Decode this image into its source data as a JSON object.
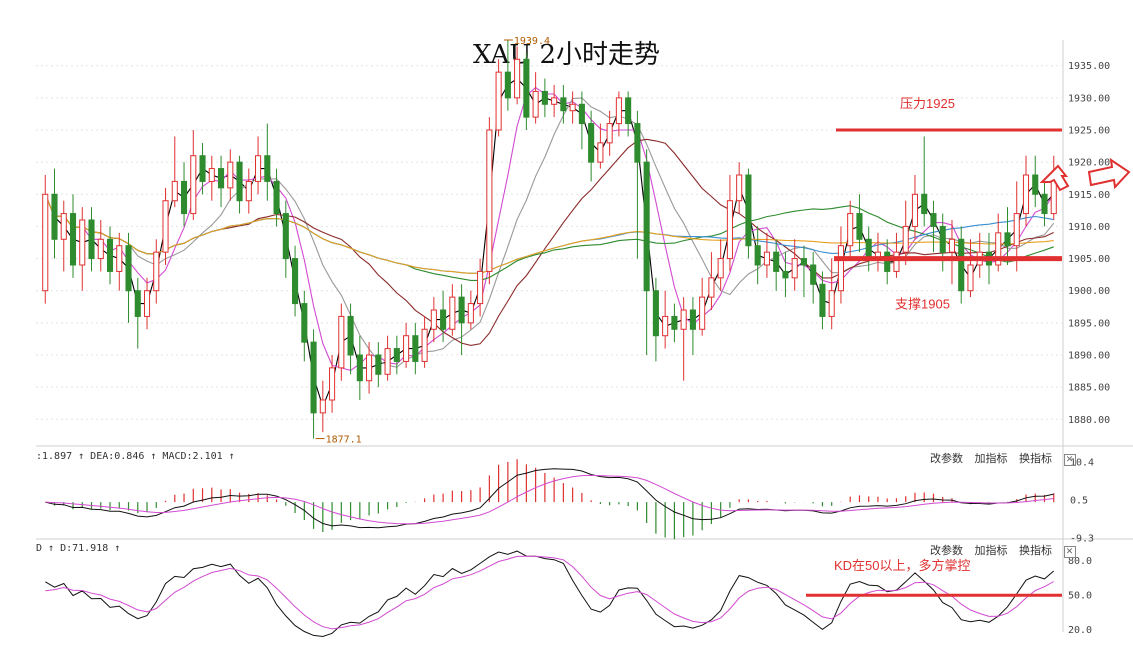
{
  "title": "XAU 2小时走势",
  "panes": {
    "macd": {
      "info": ":1.897 ↑ DEA:0.846 ↑ MACD:2.101 ↑",
      "buttons": [
        "改参数",
        "加指标",
        "换指标"
      ]
    },
    "kd": {
      "info": "D ↑ D:71.918 ↑",
      "buttons": [
        "改参数",
        "加指标",
        "换指标"
      ]
    }
  },
  "colors": {
    "up": "#e03030",
    "down": "#2e8b2e",
    "annotation": "#e03030",
    "ma_black": "#000000",
    "ma_magenta": "#d24ad2",
    "ma_gray": "#999999",
    "ma_brown": "#8b2a2a",
    "ma_green": "#2e8b2e",
    "ma_blue": "#3a8fd0",
    "ma_orange": "#e8a020"
  },
  "chart_data": [
    {
      "type": "candlestick",
      "title": "XAU 2小时走势",
      "y_ticks": [
        1880,
        1885,
        1890,
        1895,
        1900,
        1905,
        1910,
        1915,
        1920,
        1925,
        1930,
        1935
      ],
      "ylim": [
        1876,
        1939
      ],
      "y_tick_format": "two_decimals",
      "high_label": "1939.4",
      "low_label": "1877.1",
      "annotations": [
        {
          "text": "压力1925",
          "price": 1925
        },
        {
          "text": "支撑1905",
          "price": 1905
        }
      ],
      "candles": [
        [
          1900,
          1915,
          1918,
          1898
        ],
        [
          1915,
          1908,
          1919,
          1905
        ],
        [
          1908,
          1912,
          1914,
          1903
        ],
        [
          1912,
          1904,
          1915,
          1902
        ],
        [
          1904,
          1911,
          1913,
          1900
        ],
        [
          1911,
          1905,
          1913,
          1903
        ],
        [
          1905,
          1908,
          1911,
          1903
        ],
        [
          1908,
          1903,
          1910,
          1901
        ],
        [
          1903,
          1907,
          1909,
          1900
        ],
        [
          1907,
          1900,
          1909,
          1895
        ],
        [
          1900,
          1896,
          1902,
          1891
        ],
        [
          1896,
          1900,
          1902,
          1894
        ],
        [
          1900,
          1906,
          1908,
          1898
        ],
        [
          1906,
          1914,
          1916,
          1904
        ],
        [
          1914,
          1917,
          1924,
          1913
        ],
        [
          1917,
          1912,
          1920,
          1910
        ],
        [
          1912,
          1921,
          1925,
          1911
        ],
        [
          1921,
          1917,
          1923,
          1915
        ],
        [
          1917,
          1919,
          1921,
          1914
        ],
        [
          1919,
          1916,
          1921,
          1913
        ],
        [
          1916,
          1920,
          1922,
          1914
        ],
        [
          1920,
          1914,
          1921,
          1912
        ],
        [
          1914,
          1917,
          1919,
          1912
        ],
        [
          1917,
          1921,
          1924,
          1915
        ],
        [
          1921,
          1917,
          1926,
          1914
        ],
        [
          1917,
          1912,
          1919,
          1910
        ],
        [
          1912,
          1905,
          1914,
          1902
        ],
        [
          1905,
          1898,
          1907,
          1896
        ],
        [
          1898,
          1892,
          1900,
          1889
        ],
        [
          1892,
          1881,
          1894,
          1877
        ],
        [
          1881,
          1883,
          1886,
          1878
        ],
        [
          1883,
          1888,
          1890,
          1881
        ],
        [
          1888,
          1896,
          1898,
          1886
        ],
        [
          1896,
          1890,
          1898,
          1887
        ],
        [
          1890,
          1886,
          1893,
          1883
        ],
        [
          1886,
          1890,
          1892,
          1884
        ],
        [
          1890,
          1887,
          1892,
          1885
        ],
        [
          1887,
          1891,
          1893,
          1886
        ],
        [
          1891,
          1889,
          1893,
          1887
        ],
        [
          1889,
          1893,
          1895,
          1888
        ],
        [
          1893,
          1889,
          1895,
          1887
        ],
        [
          1889,
          1894,
          1896,
          1888
        ],
        [
          1894,
          1897,
          1899,
          1892
        ],
        [
          1897,
          1894,
          1900,
          1892
        ],
        [
          1894,
          1899,
          1901,
          1893
        ],
        [
          1899,
          1895,
          1901,
          1890
        ],
        [
          1895,
          1898,
          1900,
          1894
        ],
        [
          1898,
          1903,
          1905,
          1896
        ],
        [
          1903,
          1925,
          1927,
          1901
        ],
        [
          1925,
          1934,
          1936,
          1924
        ],
        [
          1934,
          1930,
          1939,
          1928
        ],
        [
          1930,
          1936,
          1938,
          1929
        ],
        [
          1936,
          1927,
          1937,
          1925
        ],
        [
          1927,
          1931,
          1934,
          1926
        ],
        [
          1931,
          1929,
          1933,
          1927
        ],
        [
          1929,
          1930,
          1932,
          1927
        ],
        [
          1930,
          1928,
          1932,
          1926
        ],
        [
          1928,
          1929,
          1931,
          1926
        ],
        [
          1929,
          1926,
          1931,
          1922
        ],
        [
          1926,
          1920,
          1928,
          1917
        ],
        [
          1920,
          1923,
          1926,
          1919
        ],
        [
          1923,
          1926,
          1928,
          1921
        ],
        [
          1926,
          1930,
          1931,
          1924
        ],
        [
          1930,
          1926,
          1931,
          1924
        ],
        [
          1926,
          1920,
          1928,
          1905
        ],
        [
          1920,
          1900,
          1922,
          1890
        ],
        [
          1900,
          1893,
          1902,
          1889
        ],
        [
          1893,
          1896,
          1900,
          1891
        ],
        [
          1896,
          1894,
          1898,
          1892
        ],
        [
          1894,
          1897,
          1899,
          1886
        ],
        [
          1897,
          1894,
          1899,
          1890
        ],
        [
          1894,
          1899,
          1902,
          1893
        ],
        [
          1899,
          1902,
          1906,
          1897
        ],
        [
          1902,
          1905,
          1908,
          1900
        ],
        [
          1905,
          1914,
          1918,
          1903
        ],
        [
          1914,
          1918,
          1920,
          1912
        ],
        [
          1918,
          1907,
          1919,
          1905
        ],
        [
          1907,
          1904,
          1910,
          1901
        ],
        [
          1904,
          1906,
          1909,
          1902
        ],
        [
          1906,
          1903,
          1908,
          1900
        ],
        [
          1903,
          1902,
          1906,
          1899
        ],
        [
          1902,
          1905,
          1908,
          1900
        ],
        [
          1905,
          1904,
          1907,
          1899
        ],
        [
          1904,
          1901,
          1906,
          1898
        ],
        [
          1901,
          1896,
          1903,
          1894
        ],
        [
          1896,
          1900,
          1905,
          1894
        ],
        [
          1900,
          1907,
          1910,
          1898
        ],
        [
          1907,
          1912,
          1914,
          1905
        ],
        [
          1912,
          1908,
          1915,
          1906
        ],
        [
          1908,
          1905,
          1910,
          1903
        ],
        [
          1905,
          1906,
          1909,
          1903
        ],
        [
          1906,
          1903,
          1908,
          1901
        ],
        [
          1903,
          1906,
          1909,
          1902
        ],
        [
          1906,
          1910,
          1914,
          1904
        ],
        [
          1910,
          1915,
          1918,
          1908
        ],
        [
          1915,
          1912,
          1924,
          1910
        ],
        [
          1912,
          1910,
          1914,
          1906
        ],
        [
          1910,
          1906,
          1912,
          1903
        ],
        [
          1906,
          1908,
          1911,
          1901
        ],
        [
          1908,
          1900,
          1910,
          1898
        ],
        [
          1900,
          1904,
          1908,
          1899
        ],
        [
          1904,
          1906,
          1909,
          1902
        ],
        [
          1906,
          1904,
          1909,
          1901
        ],
        [
          1904,
          1909,
          1912,
          1903
        ],
        [
          1909,
          1907,
          1913,
          1904
        ],
        [
          1907,
          1912,
          1917,
          1903
        ],
        [
          1912,
          1918,
          1921,
          1910
        ],
        [
          1918,
          1915,
          1921,
          1913
        ],
        [
          1915,
          1912,
          1917,
          1910
        ],
        [
          1912,
          1918,
          1921,
          1911
        ]
      ],
      "moving_averages": [
        {
          "color_key": "ma_black",
          "period": 2
        },
        {
          "color_key": "ma_magenta",
          "period": 5
        },
        {
          "color_key": "ma_gray",
          "period": 10
        },
        {
          "color_key": "ma_brown",
          "period": 20
        },
        {
          "color_key": "ma_green",
          "period": 40
        },
        {
          "color_key": "ma_blue",
          "period": 60
        },
        {
          "color_key": "ma_orange",
          "period": 100
        }
      ]
    },
    {
      "type": "macd",
      "y_ticks": [
        10.4,
        0.5,
        -9.3
      ],
      "ylim": [
        -9.3,
        10.4
      ]
    },
    {
      "type": "kd",
      "y_ticks": [
        20,
        50,
        80
      ],
      "y_tick_format": "one_decimal",
      "ylim": [
        18,
        85
      ],
      "annotation": {
        "text": "KD在50以上，多方掌控",
        "level": 50
      }
    }
  ]
}
